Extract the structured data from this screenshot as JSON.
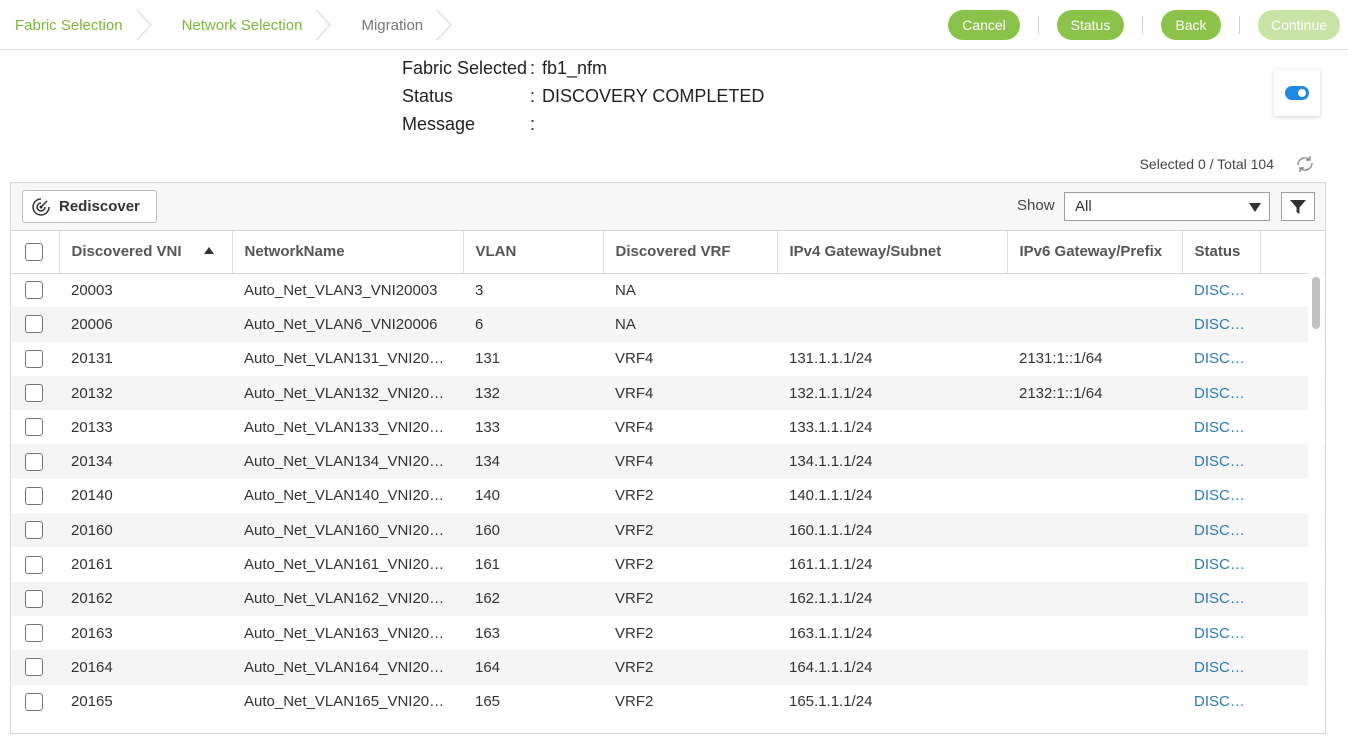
{
  "breadcrumb": {
    "steps": [
      {
        "label": "Fabric Selection"
      },
      {
        "label": "Network Selection"
      },
      {
        "label": "Migration"
      }
    ]
  },
  "actions": {
    "cancel": "Cancel",
    "status": "Status",
    "back": "Back",
    "continue": "Continue"
  },
  "fabric": {
    "selected_key": "Fabric Selected",
    "selected_value": "fb1_nfm",
    "status_key": "Status",
    "status_value": "DISCOVERY COMPLETED",
    "message_key": "Message",
    "message_value": "",
    "colon": ":"
  },
  "summary": {
    "selected_total": "Selected 0 / Total 104"
  },
  "toolbar": {
    "rediscover": "Rediscover",
    "show_label": "Show",
    "show_value": "All"
  },
  "table": {
    "columns": [
      "Discovered VNI",
      "NetworkName",
      "VLAN",
      "Discovered VRF",
      "IPv4 Gateway/Subnet",
      "IPv6 Gateway/Prefix",
      "Status"
    ],
    "rows": [
      {
        "vni": "20003",
        "name": "Auto_Net_VLAN3_VNI20003",
        "vlan": "3",
        "vrf": "NA",
        "ipv4": "",
        "ipv6": "",
        "status": "DISC…"
      },
      {
        "vni": "20006",
        "name": "Auto_Net_VLAN6_VNI20006",
        "vlan": "6",
        "vrf": "NA",
        "ipv4": "",
        "ipv6": "",
        "status": "DISC…"
      },
      {
        "vni": "20131",
        "name": "Auto_Net_VLAN131_VNI20…",
        "vlan": "131",
        "vrf": "VRF4",
        "ipv4": "131.1.1.1/24",
        "ipv6": "2131:1::1/64",
        "status": "DISC…"
      },
      {
        "vni": "20132",
        "name": "Auto_Net_VLAN132_VNI20…",
        "vlan": "132",
        "vrf": "VRF4",
        "ipv4": "132.1.1.1/24",
        "ipv6": "2132:1::1/64",
        "status": "DISC…"
      },
      {
        "vni": "20133",
        "name": "Auto_Net_VLAN133_VNI20…",
        "vlan": "133",
        "vrf": "VRF4",
        "ipv4": "133.1.1.1/24",
        "ipv6": "",
        "status": "DISC…"
      },
      {
        "vni": "20134",
        "name": "Auto_Net_VLAN134_VNI20…",
        "vlan": "134",
        "vrf": "VRF4",
        "ipv4": "134.1.1.1/24",
        "ipv6": "",
        "status": "DISC…"
      },
      {
        "vni": "20140",
        "name": "Auto_Net_VLAN140_VNI20…",
        "vlan": "140",
        "vrf": "VRF2",
        "ipv4": "140.1.1.1/24",
        "ipv6": "",
        "status": "DISC…"
      },
      {
        "vni": "20160",
        "name": "Auto_Net_VLAN160_VNI20…",
        "vlan": "160",
        "vrf": "VRF2",
        "ipv4": "160.1.1.1/24",
        "ipv6": "",
        "status": "DISC…"
      },
      {
        "vni": "20161",
        "name": "Auto_Net_VLAN161_VNI20…",
        "vlan": "161",
        "vrf": "VRF2",
        "ipv4": "161.1.1.1/24",
        "ipv6": "",
        "status": "DISC…"
      },
      {
        "vni": "20162",
        "name": "Auto_Net_VLAN162_VNI20…",
        "vlan": "162",
        "vrf": "VRF2",
        "ipv4": "162.1.1.1/24",
        "ipv6": "",
        "status": "DISC…"
      },
      {
        "vni": "20163",
        "name": "Auto_Net_VLAN163_VNI20…",
        "vlan": "163",
        "vrf": "VRF2",
        "ipv4": "163.1.1.1/24",
        "ipv6": "",
        "status": "DISC…"
      },
      {
        "vni": "20164",
        "name": "Auto_Net_VLAN164_VNI20…",
        "vlan": "164",
        "vrf": "VRF2",
        "ipv4": "164.1.1.1/24",
        "ipv6": "",
        "status": "DISC…"
      },
      {
        "vni": "20165",
        "name": "Auto_Net_VLAN165_VNI20…",
        "vlan": "165",
        "vrf": "VRF2",
        "ipv4": "165.1.1.1/24",
        "ipv6": "",
        "status": "DISC…"
      }
    ]
  },
  "colors": {
    "accent_green": "#8bc34a",
    "link_blue": "#2a7ab8",
    "toggle_blue": "#1e88e5"
  },
  "icons": {
    "rediscover": "radar-icon",
    "refresh": "refresh-icon",
    "filter": "filter-icon",
    "chevron": "chevron-right-icon"
  }
}
